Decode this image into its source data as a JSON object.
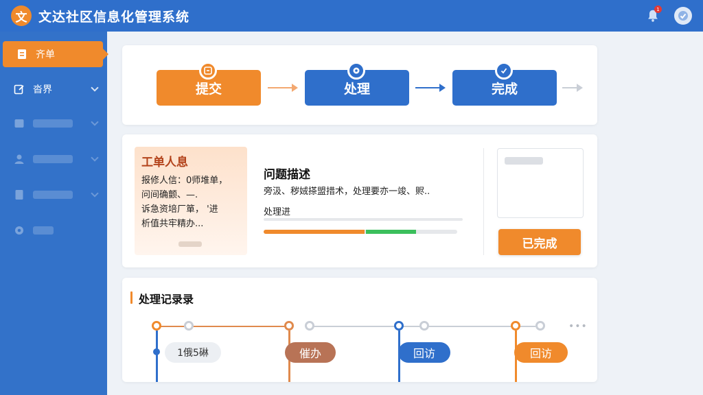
{
  "header": {
    "logo_glyph": "文",
    "app_title": "文达社区信息化管理系统",
    "notification_badge": "1"
  },
  "sidebar": {
    "items": [
      {
        "label": "齐单",
        "active": true,
        "icon": "document-icon"
      },
      {
        "label": "沓界",
        "active": false,
        "icon": "edit-icon"
      },
      {
        "label": "",
        "active": false,
        "icon": "database-icon"
      },
      {
        "label": "",
        "active": false,
        "icon": "user-icon"
      },
      {
        "label": "",
        "active": false,
        "icon": "file-icon"
      },
      {
        "label": "",
        "active": false,
        "icon": "gear-icon"
      }
    ]
  },
  "flow": {
    "steps": [
      {
        "label": "提交",
        "color": "#f08a2c",
        "icon": "submit-icon"
      },
      {
        "label": "处理",
        "color": "#2f6fcb",
        "icon": "gear-icon"
      },
      {
        "label": "完成",
        "color": "#2f6fcb",
        "icon": "check-icon"
      }
    ]
  },
  "info": {
    "title": "工单人息",
    "lines": [
      "报修人信：0师堆单，",
      "问间确颤、—.",
      "诉急资培厂箪，  '进",
      "析值共牢精办..."
    ],
    "desc_title": "问题描述",
    "desc_text": "旁汲、秽娀搽盟措术，处理要亦一竣、赆..",
    "progress_label": "处理进",
    "progress": {
      "orange": 0.52,
      "green": 0.26
    },
    "done_button": "已完成"
  },
  "records": {
    "title": "处理记录录",
    "entries": [
      {
        "label": "1俄5碄",
        "style": "light"
      },
      {
        "label": "催办",
        "style": "brown"
      },
      {
        "label": "回访",
        "style": "blue"
      },
      {
        "label": "回访",
        "style": "orange"
      }
    ],
    "more": "•••"
  },
  "colors": {
    "primary": "#2f6fcb",
    "accent": "#f08a2c",
    "success": "#3bbf5c"
  }
}
